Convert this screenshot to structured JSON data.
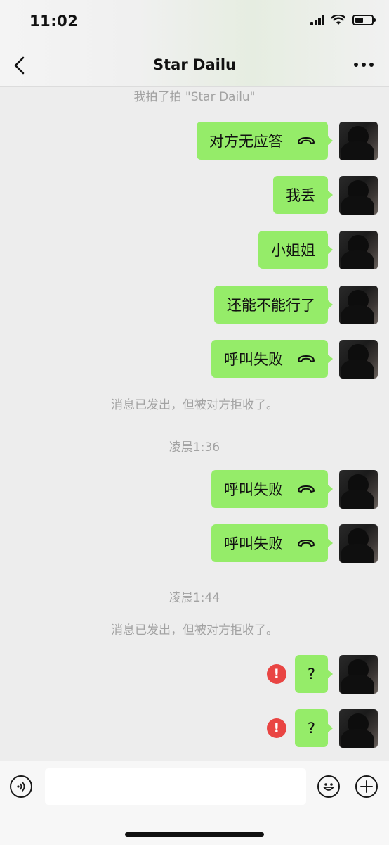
{
  "status_bar": {
    "time": "11:02"
  },
  "header": {
    "title": "Star Dailu"
  },
  "chat": {
    "pat_notice": "我拍了拍 \"Star Dailu\"",
    "messages": [
      {
        "text": "对方无应答",
        "type": "call"
      },
      {
        "text": "我丢",
        "type": "text"
      },
      {
        "text": "小姐姐",
        "type": "text"
      },
      {
        "text": "还能不能行了",
        "type": "text"
      },
      {
        "text": "呼叫失败",
        "type": "call"
      },
      {
        "text": "呼叫失败",
        "type": "call"
      },
      {
        "text": "呼叫失败",
        "type": "call"
      },
      {
        "text": "?",
        "type": "text",
        "failed": true
      },
      {
        "text": "?",
        "type": "text",
        "failed": true
      }
    ],
    "rejected_notice_1": "消息已发出，但被对方拒收了。",
    "time_1": "凌晨1:36",
    "time_2": "凌晨1:44",
    "rejected_notice_2": "消息已发出，但被对方拒收了。"
  },
  "colors": {
    "bubble": "#95ec69",
    "chat_bg": "#ededed",
    "error": "#e94543"
  },
  "icons": [
    "back-chevron-icon",
    "more-dots-icon",
    "phone-hangup-icon",
    "error-icon",
    "voice-icon",
    "emoji-icon",
    "plus-icon"
  ]
}
